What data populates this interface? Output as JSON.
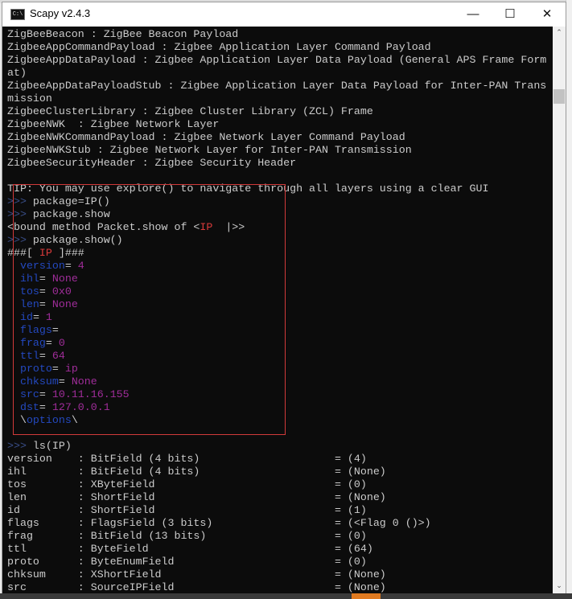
{
  "window": {
    "title": "Scapy v2.4.3",
    "icon": "console-icon",
    "minimize": "—",
    "maximize": "☐",
    "close": "✕"
  },
  "colors": {
    "background": "#0c0c0c",
    "text": "#cccccc",
    "prompt": "#3a4f8a",
    "field": "#2449c0",
    "value": "#a02d9a",
    "layer": "#d83a3a",
    "highlight_box": "#d23a3a"
  },
  "console_lines": [
    [
      [
        "ZigBeeBeacon : ZigBee Beacon Payload",
        "text"
      ]
    ],
    [
      [
        "ZigbeeAppCommandPayload : Zigbee Application Layer Command Payload",
        "text"
      ]
    ],
    [
      [
        "ZigbeeAppDataPayload : Zigbee Application Layer Data Payload (General APS Frame Form",
        "text"
      ]
    ],
    [
      [
        "at)",
        "text"
      ]
    ],
    [
      [
        "ZigbeeAppDataPayloadStub : Zigbee Application Layer Data Payload for Inter-PAN Trans",
        "text"
      ]
    ],
    [
      [
        "mission",
        "text"
      ]
    ],
    [
      [
        "ZigbeeClusterLibrary : Zigbee Cluster Library (ZCL) Frame",
        "text"
      ]
    ],
    [
      [
        "ZigbeeNWK  : Zigbee Network Layer",
        "text"
      ]
    ],
    [
      [
        "ZigbeeNWKCommandPayload : Zigbee Network Layer Command Payload",
        "text"
      ]
    ],
    [
      [
        "ZigbeeNWKStub : Zigbee Network Layer for Inter-PAN Transmission",
        "text"
      ]
    ],
    [
      [
        "ZigbeeSecurityHeader : Zigbee Security Header",
        "text"
      ]
    ],
    [
      [
        "",
        "text"
      ]
    ],
    [
      [
        "TIP: You may use explore() to navigate through all layers using a clear GUI",
        "text"
      ]
    ],
    [
      [
        ">>>",
        "prompt"
      ],
      [
        " package=IP()",
        "text"
      ]
    ],
    [
      [
        ">>>",
        "prompt"
      ],
      [
        " package.show",
        "text"
      ]
    ],
    [
      [
        "<bound method Packet.show of <",
        "text"
      ],
      [
        "IP",
        "layer"
      ],
      [
        "  |>>",
        "text"
      ]
    ],
    [
      [
        ">>>",
        "prompt"
      ],
      [
        " package.show()",
        "text"
      ]
    ],
    [
      [
        "###[ ",
        "text"
      ],
      [
        "IP",
        "layer"
      ],
      [
        " ]###",
        "text"
      ]
    ],
    [
      [
        "  ",
        "text"
      ],
      [
        "version",
        "field"
      ],
      [
        "= ",
        "text"
      ],
      [
        "4",
        "value"
      ]
    ],
    [
      [
        "  ",
        "text"
      ],
      [
        "ihl",
        "field"
      ],
      [
        "= ",
        "text"
      ],
      [
        "None",
        "value"
      ]
    ],
    [
      [
        "  ",
        "text"
      ],
      [
        "tos",
        "field"
      ],
      [
        "= ",
        "text"
      ],
      [
        "0x0",
        "value"
      ]
    ],
    [
      [
        "  ",
        "text"
      ],
      [
        "len",
        "field"
      ],
      [
        "= ",
        "text"
      ],
      [
        "None",
        "value"
      ]
    ],
    [
      [
        "  ",
        "text"
      ],
      [
        "id",
        "field"
      ],
      [
        "= ",
        "text"
      ],
      [
        "1",
        "value"
      ]
    ],
    [
      [
        "  ",
        "text"
      ],
      [
        "flags",
        "field"
      ],
      [
        "= ",
        "text"
      ]
    ],
    [
      [
        "  ",
        "text"
      ],
      [
        "frag",
        "field"
      ],
      [
        "= ",
        "text"
      ],
      [
        "0",
        "value"
      ]
    ],
    [
      [
        "  ",
        "text"
      ],
      [
        "ttl",
        "field"
      ],
      [
        "= ",
        "text"
      ],
      [
        "64",
        "value"
      ]
    ],
    [
      [
        "  ",
        "text"
      ],
      [
        "proto",
        "field"
      ],
      [
        "= ",
        "text"
      ],
      [
        "ip",
        "value"
      ]
    ],
    [
      [
        "  ",
        "text"
      ],
      [
        "chksum",
        "field"
      ],
      [
        "= ",
        "text"
      ],
      [
        "None",
        "value"
      ]
    ],
    [
      [
        "  ",
        "text"
      ],
      [
        "src",
        "field"
      ],
      [
        "= ",
        "text"
      ],
      [
        "10.11.16.155",
        "value"
      ]
    ],
    [
      [
        "  ",
        "text"
      ],
      [
        "dst",
        "field"
      ],
      [
        "= ",
        "text"
      ],
      [
        "127.0.0.1",
        "value"
      ]
    ],
    [
      [
        "  \\",
        "text"
      ],
      [
        "options",
        "field"
      ],
      [
        "\\",
        "text"
      ]
    ],
    [
      [
        "",
        "text"
      ]
    ],
    [
      [
        ">>>",
        "prompt"
      ],
      [
        " ls(IP)",
        "text"
      ]
    ],
    [
      [
        "version    : BitField (4 bits)                     = (4)",
        "text"
      ]
    ],
    [
      [
        "ihl        : BitField (4 bits)                     = (None)",
        "text"
      ]
    ],
    [
      [
        "tos        : XByteField                            = (0)",
        "text"
      ]
    ],
    [
      [
        "len        : ShortField                            = (None)",
        "text"
      ]
    ],
    [
      [
        "id         : ShortField                            = (1)",
        "text"
      ]
    ],
    [
      [
        "flags      : FlagsField (3 bits)                   = (<Flag 0 ()>)",
        "text"
      ]
    ],
    [
      [
        "frag       : BitField (13 bits)                    = (0)",
        "text"
      ]
    ],
    [
      [
        "ttl        : ByteField                             = (64)",
        "text"
      ]
    ],
    [
      [
        "proto      : ByteEnumField                         = (0)",
        "text"
      ]
    ],
    [
      [
        "chksum     : XShortField                           = (None)",
        "text"
      ]
    ],
    [
      [
        "src        : SourceIPField                         = (None)",
        "text"
      ]
    ]
  ],
  "scrollbar": {
    "up": "⌃",
    "down": "⌄"
  }
}
